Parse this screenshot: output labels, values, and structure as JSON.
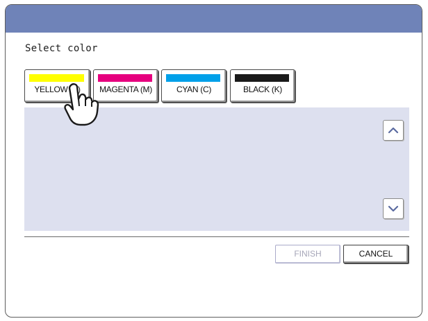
{
  "prompt_text": "Select color",
  "color_buttons": [
    {
      "label": "YELLOW (Y)",
      "swatch": "#ffff00"
    },
    {
      "label": "MAGENTA (M)",
      "swatch": "#e6007e"
    },
    {
      "label": "CYAN (C)",
      "swatch": "#00a0e9"
    },
    {
      "label": "BLACK (K)",
      "swatch": "#1a1a1a"
    }
  ],
  "actions": {
    "finish_label": "FINISH",
    "cancel_label": "CANCEL"
  },
  "colors": {
    "titlebar": "#6f83b8",
    "list_panel": "#dde0ef",
    "disabled_text": "#a6a6b8"
  },
  "icons": {
    "scroll_up": "chevron-up-icon",
    "scroll_down": "chevron-down-icon",
    "pointer": "pointing-hand-icon"
  }
}
